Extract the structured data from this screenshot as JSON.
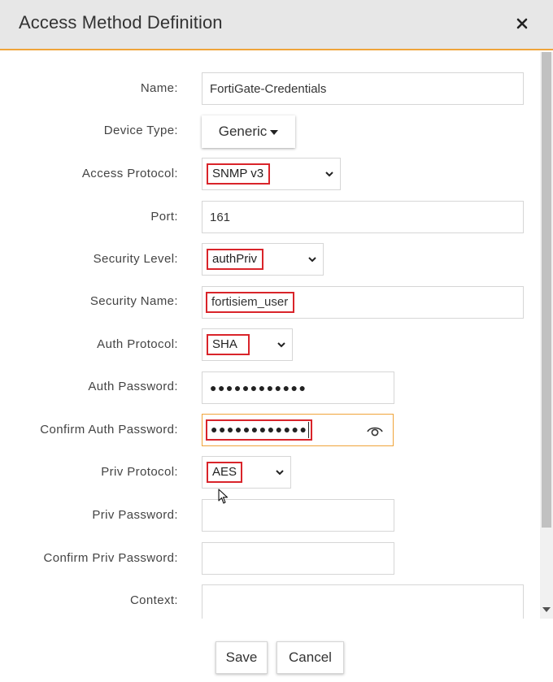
{
  "dialog": {
    "title": "Access Method Definition",
    "accent_color": "#f0a43a",
    "highlight_color": "#d9242a"
  },
  "form": {
    "name": {
      "label": "Name:",
      "value": "FortiGate-Credentials"
    },
    "device_type": {
      "label": "Device Type:",
      "value": "Generic"
    },
    "access_protocol": {
      "label": "Access Protocol:",
      "value": "SNMP v3"
    },
    "port": {
      "label": "Port:",
      "value": "161"
    },
    "security_level": {
      "label": "Security Level:",
      "value": "authPriv"
    },
    "security_name": {
      "label": "Security Name:",
      "value": "fortisiem_user"
    },
    "auth_protocol": {
      "label": "Auth Protocol:",
      "value": "SHA"
    },
    "auth_password": {
      "label": "Auth Password:",
      "value": "●●●●●●●●●●●●"
    },
    "confirm_auth_password": {
      "label": "Confirm Auth Password:",
      "value": "●●●●●●●●●●●●"
    },
    "priv_protocol": {
      "label": "Priv Protocol:",
      "value": "AES"
    },
    "priv_password": {
      "label": "Priv Password:",
      "value": ""
    },
    "confirm_priv_password": {
      "label": "Confirm Priv Password:",
      "value": ""
    },
    "context": {
      "label": "Context:",
      "value": ""
    }
  },
  "footer": {
    "save_label": "Save",
    "cancel_label": "Cancel"
  }
}
